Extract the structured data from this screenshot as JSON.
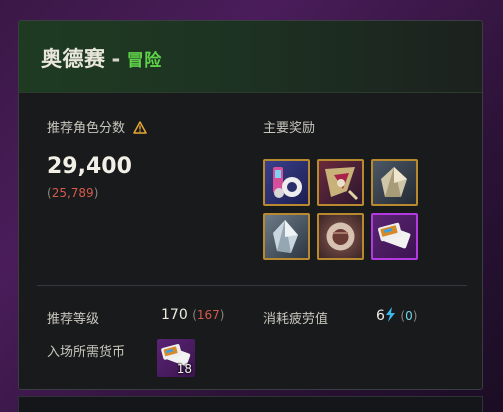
{
  "header": {
    "title": "奥德赛",
    "separator": "-",
    "mode": "冒险"
  },
  "recommended": {
    "label": "推荐角色分数",
    "score": "29,400",
    "current_score_open": "(",
    "current_score": "25,789",
    "current_score_close": ")"
  },
  "rewards": {
    "label": "主要奖励",
    "items": [
      {
        "icon": "chronicle-gear-icon",
        "rarity": "gold"
      },
      {
        "icon": "shield-wing-icon",
        "rarity": "gold"
      },
      {
        "icon": "crystal-ore-icon",
        "rarity": "gold"
      },
      {
        "icon": "crystal-ore-icon",
        "rarity": "gold"
      },
      {
        "icon": "fragment-orb-icon",
        "rarity": "gold"
      },
      {
        "icon": "ticket-card-icon",
        "rarity": "purple"
      }
    ]
  },
  "level": {
    "label": "推荐等级",
    "value": "170",
    "open": "(",
    "current": "167",
    "close": ")"
  },
  "fatigue": {
    "label": "消耗疲劳值",
    "value": "6",
    "open": "(",
    "current": "0",
    "close": ")"
  },
  "currency": {
    "label": "入场所需货币",
    "icon": "ticket-card-icon",
    "quantity": "18"
  }
}
